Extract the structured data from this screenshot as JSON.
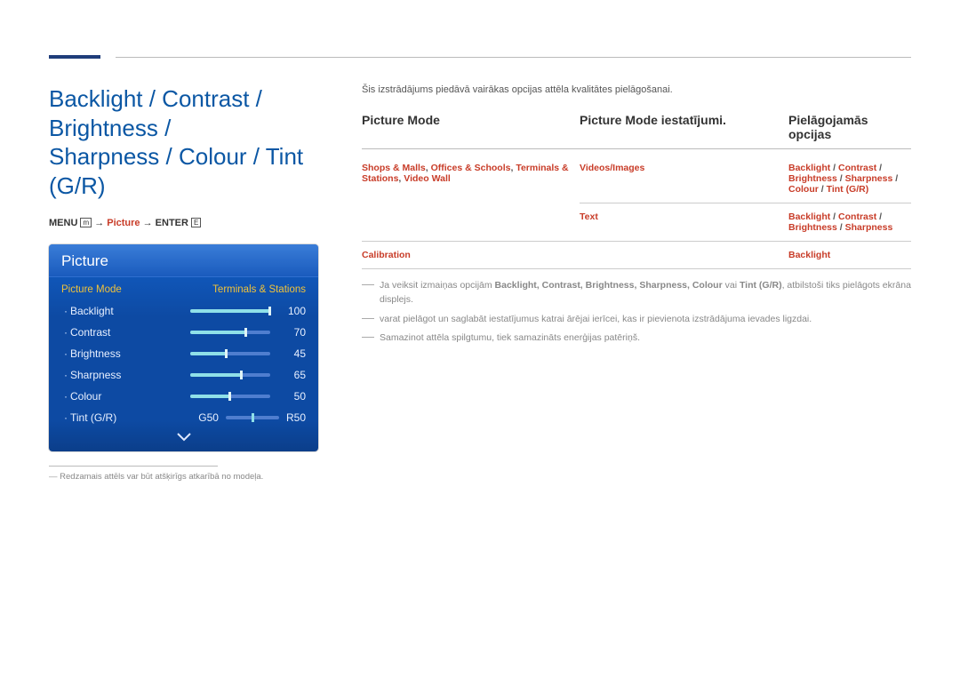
{
  "title_line1": "Backlight / Contrast / Brightness /",
  "title_line2": "Sharpness / Colour / Tint (G/R)",
  "breadcrumb": {
    "menu": "MENU",
    "menu_icon": "m",
    "arrow": "→",
    "picture": "Picture",
    "enter": "ENTER",
    "enter_icon": "E"
  },
  "osd": {
    "header": "Picture",
    "mode_label": "Picture Mode",
    "mode_value": "Terminals & Stations",
    "items": [
      {
        "name": "Backlight",
        "value": "100",
        "pct": 100
      },
      {
        "name": "Contrast",
        "value": "70",
        "pct": 70
      },
      {
        "name": "Brightness",
        "value": "45",
        "pct": 45
      },
      {
        "name": "Sharpness",
        "value": "65",
        "pct": 65
      },
      {
        "name": "Colour",
        "value": "50",
        "pct": 50
      }
    ],
    "tint": {
      "name": "Tint (G/R)",
      "g": "G50",
      "r": "R50",
      "pct": 50
    }
  },
  "footnote": "Redzamais attēls var būt atšķirīgs atkarībā no modeļa.",
  "intro": "Šis izstrādājums piedāvā vairākas opcijas attēla kvalitātes pielāgošanai.",
  "table_head": {
    "c1": "Picture Mode",
    "c2": "Picture Mode iestatījumi.",
    "c3": "Pielāgojamās opcijas"
  },
  "rows": [
    {
      "c1": "Shops & Malls, Offices & Schools, Terminals & Stations, Video Wall",
      "c2": "Videos/Images",
      "c3": "Backlight / Contrast / Brightness / Sharpness / Colour / Tint (G/R)"
    },
    {
      "c1": "",
      "c2": "Text",
      "c3": "Backlight / Contrast / Brightness / Sharpness"
    },
    {
      "c1": "Calibration",
      "c2": "",
      "c3": "Backlight"
    }
  ],
  "notes": [
    {
      "pre": "Ja veiksit izmaiņas opcijām ",
      "bold": "Backlight, Contrast, Brightness, Sharpness, Colour",
      "mid": " vai ",
      "bold2": "Tint (G/R)",
      "post": ", atbilstoši tiks pielāgots ekrāna displejs."
    },
    {
      "text": "varat pielāgot un saglabāt iestatījumus katrai ārējai ierīcei, kas ir pievienota izstrādājuma ievades ligzdai."
    },
    {
      "text": "Samazinot attēla spilgtumu, tiek samazināts enerģijas patēriņš."
    }
  ]
}
